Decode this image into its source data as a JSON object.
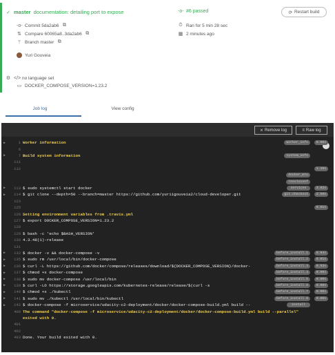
{
  "summary": {
    "branch": "master",
    "commit_message": "documentation: detailing port to expose",
    "status": "#6 passed",
    "restart_label": "Restart build",
    "commit": "Commit 5da2ab6",
    "compare": "Compare 60065a8..3da2ab6",
    "branch_line": "Branch master",
    "ran_for": "Ran for 5 min 28 sec",
    "time_ago": "2 minutes ago",
    "author": "Yuri Gouveia",
    "language": "no language set",
    "env_var": "DOCKER_COMPOSE_VERSION=1.23.2",
    "status_color": "#39aa56"
  },
  "tabs": [
    "Job log",
    "View config"
  ],
  "log_toolbar": {
    "remove_log": "Remove log",
    "raw_log": "Raw log"
  },
  "log_lines": [
    {
      "num": "1",
      "text": "Worker information",
      "style": "yellow",
      "fold": "worker_info",
      "dur": "0.00s",
      "tri": true
    },
    {
      "num": "6",
      "text": "",
      "style": "",
      "fold": "",
      "dur": "",
      "tri": false
    },
    {
      "num": "7",
      "text": "Build system information",
      "style": "yellow",
      "fold": "system_info",
      "dur": "",
      "tri": true
    },
    {
      "num": "111",
      "text": "",
      "style": "",
      "fold": "",
      "dur": "",
      "tri": false
    },
    {
      "num": "112",
      "text": "",
      "style": "",
      "fold": "",
      "dur": "1.39s",
      "tri": false
    },
    {
      "num": "",
      "text": "",
      "style": "",
      "fold": "docker_mtu",
      "dur": "",
      "tri": false
    },
    {
      "num": "",
      "text": "",
      "style": "",
      "fold": "resolvconf",
      "dur": "",
      "tri": false
    },
    {
      "num": "113",
      "text": "$ sudo systemctl start docker",
      "style": "",
      "fold": "services",
      "dur": "3.02s",
      "tri": true
    },
    {
      "num": "114",
      "text": "$ git clone --depth=50 --branch=master https://github.com/yuriigouveia2/cloud-developer.git",
      "style": "",
      "fold": "git.checkout",
      "dur": "2.50s",
      "tri": true
    },
    {
      "num": "123",
      "text": "",
      "style": "",
      "fold": "",
      "dur": "",
      "tri": false
    },
    {
      "num": "125",
      "text": "",
      "style": "",
      "fold": "",
      "dur": "0.01s",
      "tri": false
    },
    {
      "num": "126",
      "text": "Setting environment variables from .travis.yml",
      "style": "yellow",
      "fold": "",
      "dur": "",
      "tri": false
    },
    {
      "num": "127",
      "text": "$ export DOCKER_COMPOSE_VERSION=1.23.2",
      "style": "",
      "fold": "",
      "dur": "",
      "tri": false
    },
    {
      "num": "128",
      "text": "",
      "style": "",
      "fold": "",
      "dur": "",
      "tri": false
    },
    {
      "num": "129",
      "text": "$ bash -c 'echo $BASH_VERSION'",
      "style": "",
      "fold": "",
      "dur": "",
      "tri": false
    },
    {
      "num": "130",
      "text": "4.3.48(1)-release",
      "style": "",
      "fold": "",
      "dur": "",
      "tri": false
    },
    {
      "num": "131",
      "text": "",
      "style": "",
      "fold": "",
      "dur": "",
      "tri": false
    },
    {
      "num": "132",
      "text": "$ docker -v && docker-compose -v",
      "style": "",
      "fold": "before_install.1",
      "dur": "0.04s",
      "tri": true
    },
    {
      "num": "135",
      "text": "$ sudo rm /usr/local/bin/docker-compose",
      "style": "",
      "fold": "before_install.2",
      "dur": "0.01s",
      "tri": true
    },
    {
      "num": "136",
      "text": "$ curl -L https://github.com/docker/compose/releases/download/${DOCKER_COMPOSE_VERSION}/docker-",
      "style": "",
      "fold": "before_install.3",
      "dur": "0.93s",
      "tri": true
    },
    {
      "num": "137",
      "text": "$ chmod +x docker-compose",
      "style": "",
      "fold": "before_install.4",
      "dur": "0.00s",
      "tri": true
    },
    {
      "num": "138",
      "text": "$ sudo mv docker-compose /usr/local/bin",
      "style": "",
      "fold": "before_install.5",
      "dur": "0.00s",
      "tri": true
    },
    {
      "num": "139",
      "text": "$ curl -LO https://storage.googleapis.com/kubernetes-release/release/$(curl -s",
      "style": "",
      "fold": "before_install.6",
      "dur": "0.00s",
      "tri": true
    },
    {
      "num": "140",
      "text": "$ chmod +x ./kubectl",
      "style": "",
      "fold": "before_install.7",
      "dur": "0.00s",
      "tri": true
    },
    {
      "num": "141",
      "text": "$ sudo mv ./kubectl /usr/local/bin/kubectl",
      "style": "",
      "fold": "before_install.8",
      "dur": "0.00s",
      "tri": true
    },
    {
      "num": "142",
      "text": "$ docker-compose -f microservice/udacity-c2-deployment/docker/docker-compose-build.yml build --",
      "style": "",
      "fold": "install",
      "dur": "",
      "tri": true
    },
    {
      "num": "400",
      "text": "The command \"docker-compose -f microservice/udacity-c2-deployment/docker/docker-compose-build.yml build --parallel\"",
      "style": "yellow",
      "fold": "",
      "dur": "",
      "tri": false
    },
    {
      "num": "",
      "text": "exited with 0.",
      "style": "yellow",
      "fold": "",
      "dur": "",
      "tri": false
    },
    {
      "num": "401",
      "text": "",
      "style": "",
      "fold": "",
      "dur": "",
      "tri": false
    },
    {
      "num": "402",
      "text": "",
      "style": "",
      "fold": "",
      "dur": "",
      "tri": false
    },
    {
      "num": "403",
      "text": "Done. Your build exited with 0.",
      "style": "",
      "fold": "",
      "dur": "",
      "tri": false
    }
  ]
}
